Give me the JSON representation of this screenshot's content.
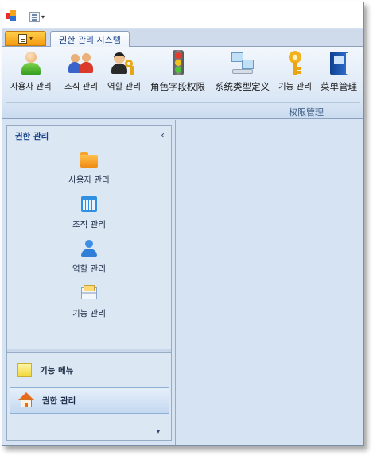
{
  "quick_access": {
    "logo_icon": "app-logo-icon",
    "toolbar_icon": "layout-icon",
    "arrow": "▾"
  },
  "tabs": [
    {
      "label": "권한 관리 시스템"
    }
  ],
  "app_button": {
    "icon": "document-icon",
    "arrow": "▾"
  },
  "ribbon": {
    "buttons": [
      {
        "label": "사용자 관리",
        "icon": "user-icon"
      },
      {
        "label": "조직 관리",
        "icon": "users-group-icon"
      },
      {
        "label": "역할 관리",
        "icon": "role-key-icon"
      },
      {
        "label": "角色字段权限",
        "icon": "traffic-light-icon"
      },
      {
        "label": "系统类型定义",
        "icon": "network-icon"
      },
      {
        "label": "기능 관리",
        "icon": "key-icon"
      },
      {
        "label": "菜单管理",
        "icon": "book-icon"
      }
    ],
    "group_label": "权限管理"
  },
  "nav": {
    "title": "권한 관리",
    "collapse": "‹",
    "items": [
      {
        "label": "사용자 관리",
        "icon": "folder-icon"
      },
      {
        "label": "조직 관리",
        "icon": "calendar-icon"
      },
      {
        "label": "역할 관리",
        "icon": "person-icon"
      },
      {
        "label": "기능 관리",
        "icon": "mail-icon"
      }
    ],
    "groups": [
      {
        "label": "기능 메뉴",
        "icon": "note-icon",
        "active": false
      },
      {
        "label": "권한 관리",
        "icon": "home-icon",
        "active": true
      }
    ],
    "bottom_arrow": "▾"
  },
  "colors": {
    "ribbon_text": "#15428b",
    "accent_orange": "#f59a10",
    "pane_bg": "#d6e3f2"
  }
}
